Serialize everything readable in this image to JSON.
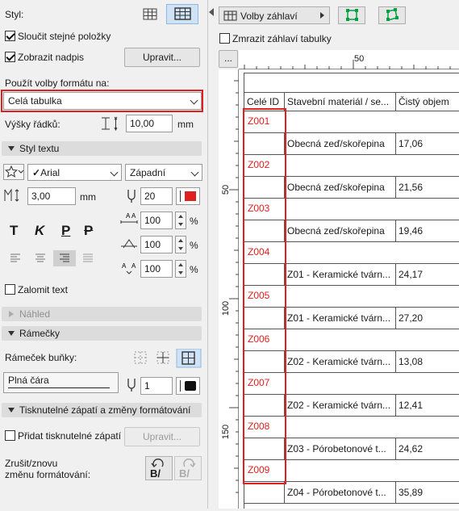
{
  "left_panel": {
    "style_label": "Styl:",
    "merge_items_label": "Sloučit stejné položky",
    "show_title_label": "Zobrazit nadpis",
    "edit_button": "Upravit...",
    "apply_format_label": "Použít volby formátu na:",
    "apply_format_value": "Celá tabulka",
    "row_height_label": "Výšky řádků:",
    "row_height_value": "10,00",
    "row_height_unit": "mm",
    "text_style_section": "Styl textu",
    "font_value": "Arial",
    "font_script_value": "Západní",
    "font_size_value": "3,00",
    "font_size_unit": "mm",
    "pen_value": "20",
    "pen_color": "#e0201f",
    "bold_glyph": "T",
    "italic_glyph": "K",
    "underline_glyph": "P",
    "strike_glyph": "P",
    "percent_1": "100",
    "percent_2": "100",
    "percent_3": "100",
    "percent_unit": "%",
    "wrap_text_label": "Zalomit text",
    "preview_section": "Náhled",
    "frames_section": "Rámečky",
    "cell_frame_label": "Rámeček buňky:",
    "line_type_value": "Plná čára",
    "frame_pen_value": "1",
    "frame_pen_color": "#111111",
    "printable_footer_section": "Tisknutelné zápatí a změny formátování",
    "add_footer_label": "Přidat tisknutelné zápatí",
    "footer_edit_button": "Upravit...",
    "undo_label_1": "Zrušit/znovu",
    "undo_label_2": "změnu formátování:",
    "undo_glyph": "B/",
    "redo_glyph": "B/"
  },
  "right_panel": {
    "header_options_button": "Volby záhlaví",
    "freeze_header_label": "Zmrazit záhlaví tabulky",
    "ruler_button": "...",
    "ruler_h_label": "50",
    "ruler_v_labels": [
      "50",
      "100",
      "150"
    ]
  },
  "table": {
    "headers": [
      "Celé ID",
      "Stavební materiál / se...",
      "Čistý objem"
    ],
    "rows": [
      {
        "id": "Z001",
        "material": "Obecná zeď/skořepina",
        "volume": "17,06"
      },
      {
        "id": "Z002",
        "material": "Obecná zeď/skořepina",
        "volume": "21,56"
      },
      {
        "id": "Z003",
        "material": "Obecná zeď/skořepina",
        "volume": "19,46"
      },
      {
        "id": "Z004",
        "material": "Z01 - Keramické tvárn...",
        "volume": "24,17"
      },
      {
        "id": "Z005",
        "material": "Z01 - Keramické tvárn...",
        "volume": "27,20"
      },
      {
        "id": "Z006",
        "material": "Z02 - Keramické tvárn...",
        "volume": "13,08"
      },
      {
        "id": "Z007",
        "material": "Z02 - Keramické tvárn...",
        "volume": "12,41"
      },
      {
        "id": "Z008",
        "material": "Z03 - Pórobetonové t...",
        "volume": "24,62"
      },
      {
        "id": "Z009",
        "material": "Z04 - Pórobetonové t...",
        "volume": "35,89"
      }
    ]
  },
  "colors": {
    "accent_red": "#e0201f",
    "selected_blue": "#cfe2f6"
  }
}
